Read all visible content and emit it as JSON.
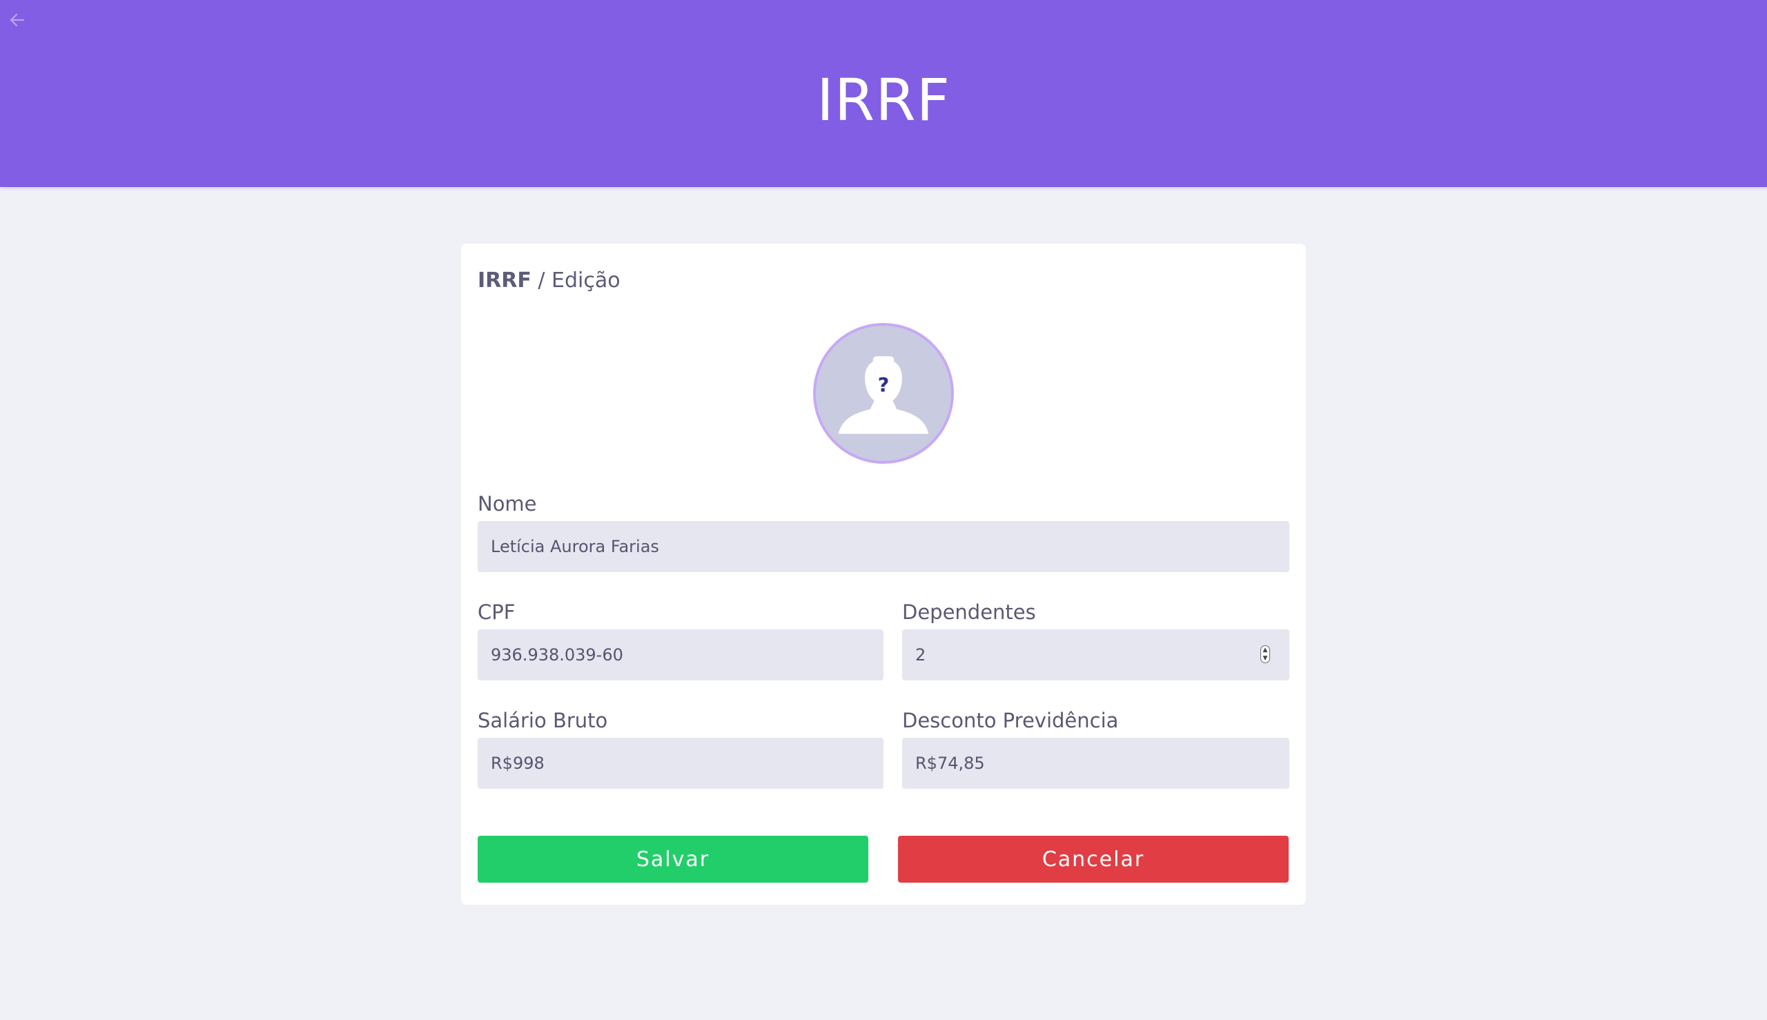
{
  "header": {
    "title": "IRRF",
    "back_icon": "arrow-left-icon"
  },
  "breadcrumb": {
    "section": "IRRF",
    "separator": " / ",
    "page": "Edição"
  },
  "avatar": {
    "icon": "unknown-user-avatar-icon",
    "glyph": "?"
  },
  "form": {
    "nome": {
      "label": "Nome",
      "value": "Letícia Aurora Farias"
    },
    "cpf": {
      "label": "CPF",
      "value": "936.938.039-60"
    },
    "dependentes": {
      "label": "Dependentes",
      "value": "2"
    },
    "salario_bruto": {
      "label": "Salário Bruto",
      "value": "R$998"
    },
    "desconto_previdencia": {
      "label": "Desconto Previdência",
      "value": "R$74,85"
    }
  },
  "actions": {
    "save_label": "Salvar",
    "cancel_label": "Cancelar"
  },
  "colors": {
    "header": "#825ee4",
    "background": "#f0f0f7",
    "save": "#22ce6a",
    "cancel": "#e03e44",
    "input": "#e6e6f0"
  }
}
